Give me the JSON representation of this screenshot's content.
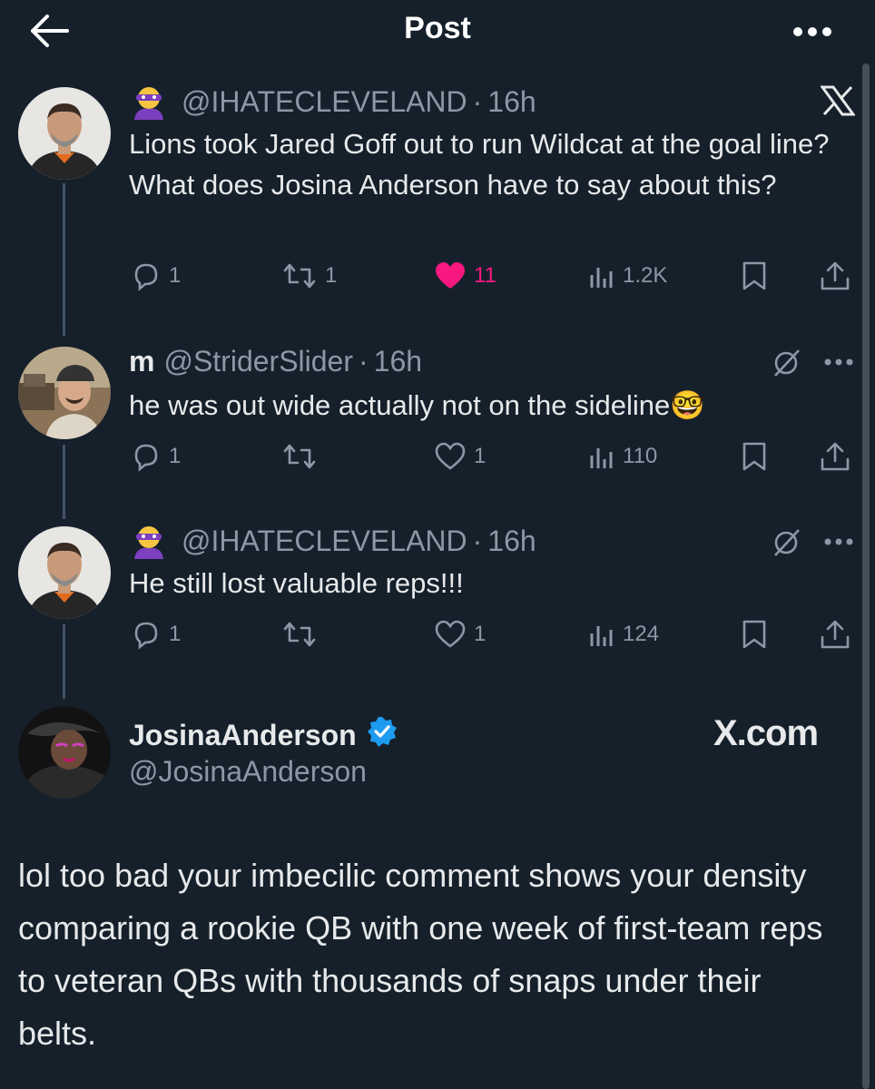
{
  "header": {
    "title": "Post"
  },
  "tweets": [
    {
      "display_name": "",
      "handle": "@IHATECLEVELAND",
      "time": "16h",
      "text": "Lions took Jared Goff out to run Wildcat at the goal line? What does Josina Anderson have to say about this?",
      "replies": "1",
      "reposts": "1",
      "likes": "11",
      "views": "1.2K"
    },
    {
      "display_name": "m",
      "handle": "@StriderSlider",
      "time": "16h",
      "text": "he was out wide actually not on the sideline🤓",
      "replies": "1",
      "reposts": "",
      "likes": "1",
      "views": "110"
    },
    {
      "display_name": "",
      "handle": "@IHATECLEVELAND",
      "time": "16h",
      "text": "He still lost valuable reps!!!",
      "replies": "1",
      "reposts": "",
      "likes": "1",
      "views": "124"
    }
  ],
  "main_post": {
    "display_name": "JosinaAnderson",
    "handle": "@JosinaAnderson",
    "watermark": "X.com",
    "text": "lol too bad your imbecilic comment shows your density comparing a rookie QB with one week of first-team reps to veteran QBs with thousands of snaps under their belts."
  },
  "colors": {
    "background": "#15202b",
    "like": "#f91880",
    "verified": "#1d9bf0",
    "muted": "#8b98a5"
  },
  "icons": [
    "back-arrow-icon",
    "more-icon",
    "x-logo-icon",
    "reply-icon",
    "repost-icon",
    "like-icon",
    "views-icon",
    "bookmark-icon",
    "share-icon",
    "grok-icon",
    "verified-icon"
  ]
}
